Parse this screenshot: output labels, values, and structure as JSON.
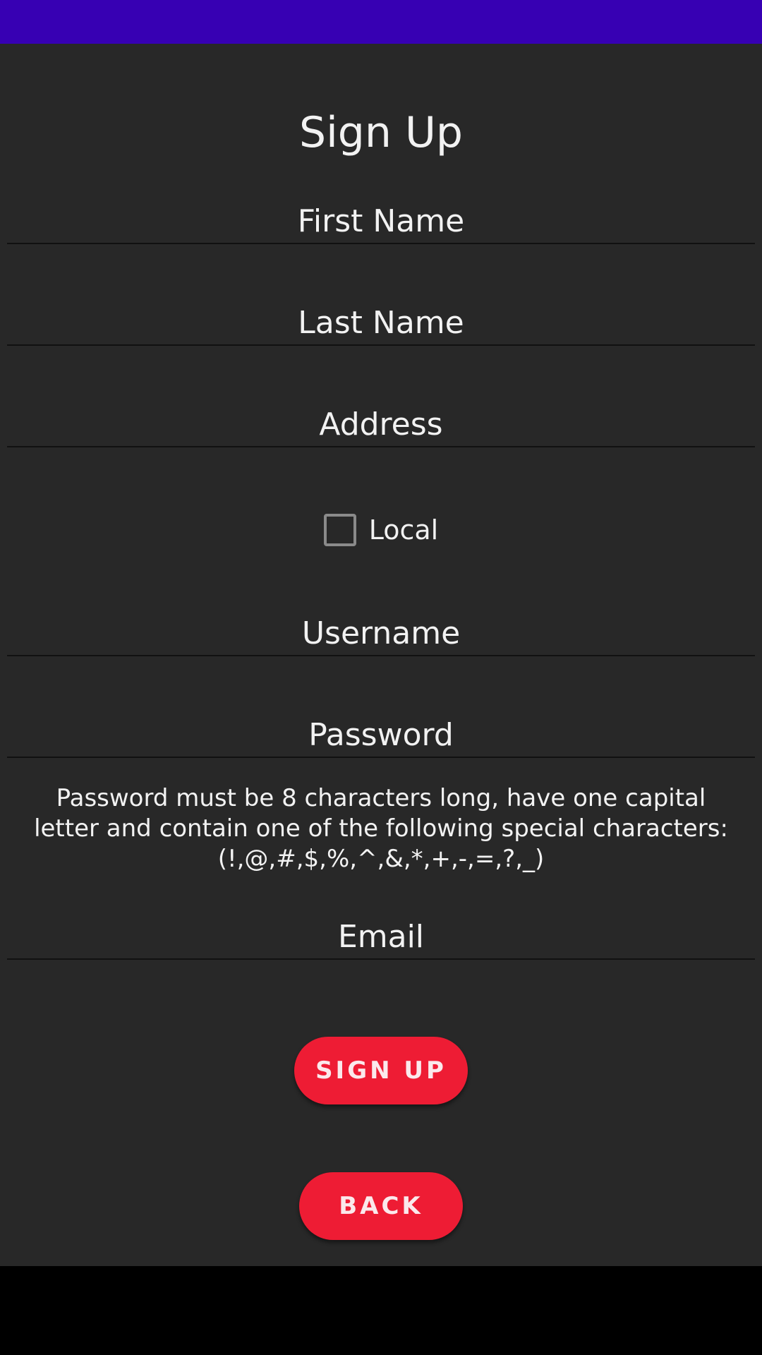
{
  "page": {
    "title": "Sign Up"
  },
  "form": {
    "first_name": {
      "value": "",
      "placeholder": "First Name"
    },
    "last_name": {
      "value": "",
      "placeholder": "Last Name"
    },
    "address": {
      "value": "",
      "placeholder": "Address"
    },
    "local_checkbox": {
      "label": "Local",
      "checked": false
    },
    "username": {
      "value": "",
      "placeholder": "Username"
    },
    "password": {
      "value": "",
      "placeholder": "Password"
    },
    "password_hint": "Password must be 8 characters long, have one capital letter and contain one of the following special characters: (!,@,#,$,%,^,&,*,+,-,=,?,_)",
    "email": {
      "value": "",
      "placeholder": "Email"
    }
  },
  "buttons": {
    "sign_up_label": "SIGN UP",
    "back_label": "BACK"
  },
  "colors": {
    "status_bar": "#3700b3",
    "background": "#282828",
    "accent_button": "#ee1c34",
    "text": "#f2f2f2"
  }
}
